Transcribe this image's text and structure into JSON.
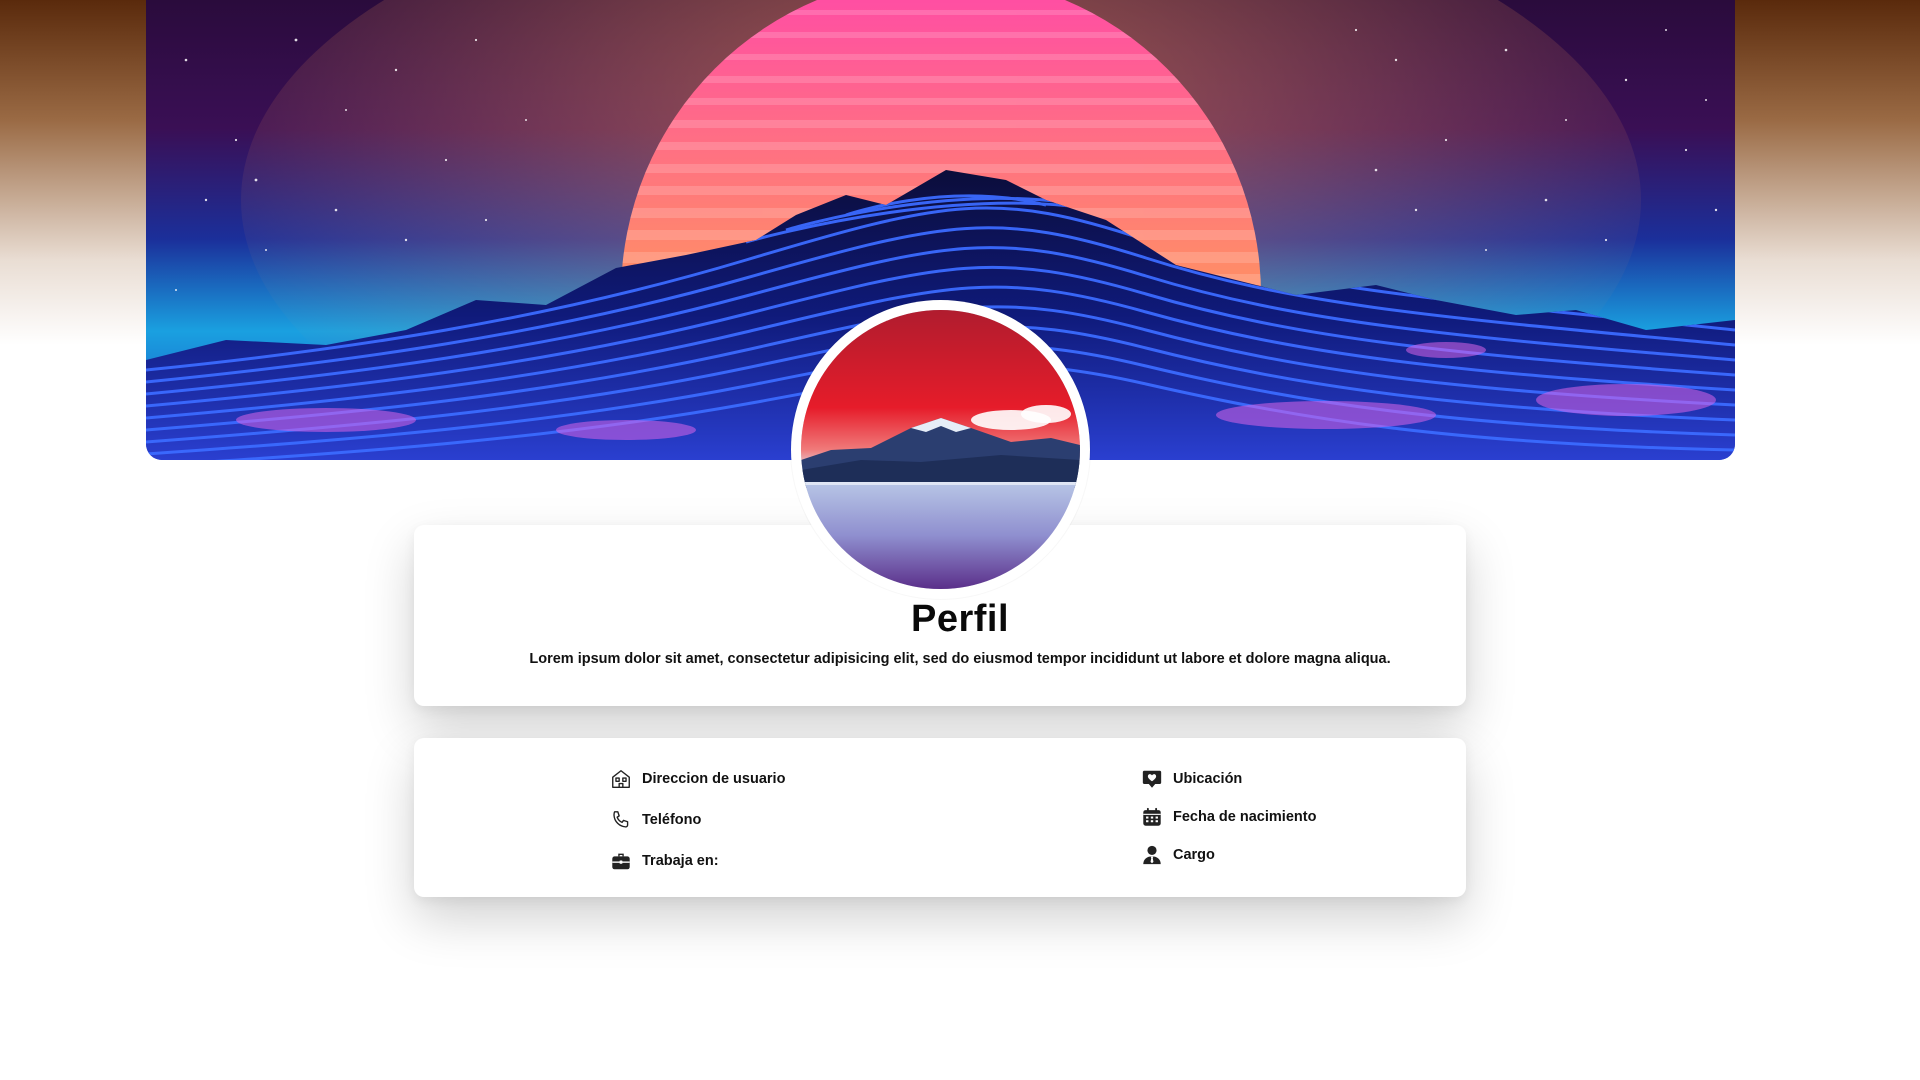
{
  "profile": {
    "title": "Perfil",
    "description": "Lorem ipsum dolor sit amet, consectetur adipisicing elit, sed do eiusmod tempor incididunt ut labore et dolore magna aliqua."
  },
  "info": {
    "left": [
      {
        "icon": "house-icon",
        "label": "Direccion de usuario"
      },
      {
        "icon": "phone-icon",
        "label": "Teléfono"
      },
      {
        "icon": "briefcase-icon",
        "label": "Trabaja en:"
      }
    ],
    "right": [
      {
        "icon": "location-heart-icon",
        "label": "Ubicación"
      },
      {
        "icon": "calendar-icon",
        "label": "Fecha de nacimiento"
      },
      {
        "icon": "user-tie-icon",
        "label": "Cargo"
      }
    ]
  },
  "colors": {
    "sun_top": "#ff4fa3",
    "sun_bottom": "#ffb020",
    "mountain_line": "#3b6bff",
    "avatar_sky": "#e61c2a"
  }
}
